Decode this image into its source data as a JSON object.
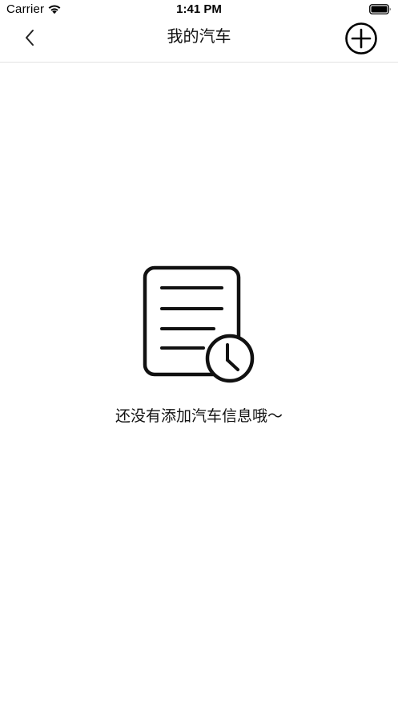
{
  "status_bar": {
    "carrier": "Carrier",
    "time": "1:41 PM",
    "wifi_icon": "wifi-icon",
    "battery_icon": "battery-icon"
  },
  "nav": {
    "title": "我的汽车",
    "back_icon": "chevron-left-icon",
    "add_icon": "circle-plus-icon"
  },
  "empty_state": {
    "icon": "document-clock-icon",
    "message": "还没有添加汽车信息哦～"
  },
  "colors": {
    "background": "#ffffff",
    "text": "#111111",
    "divider": "#e3e3e3"
  }
}
